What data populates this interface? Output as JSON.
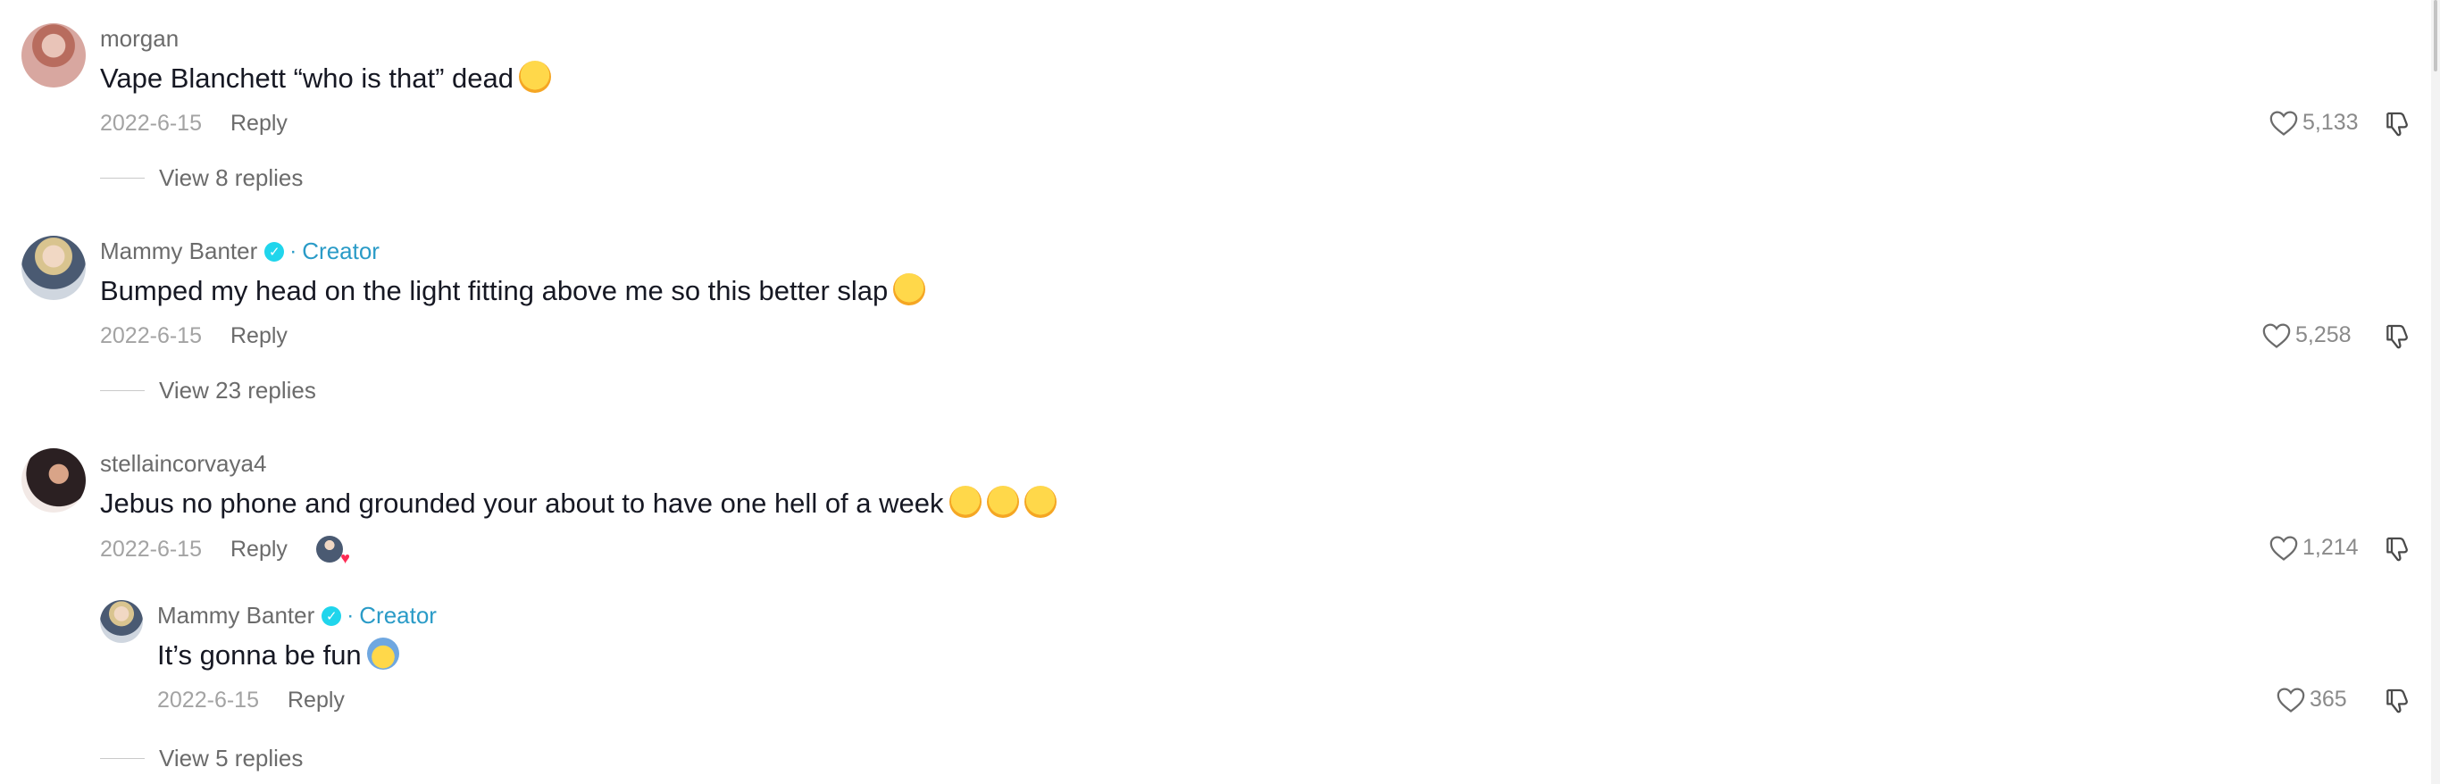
{
  "comments": [
    {
      "username": "morgan",
      "creator": false,
      "text": "Vape Blanchett “who is that” dead",
      "date": "2022-6-15",
      "reply_label": "Reply",
      "likes": "5,133",
      "view_replies": "View 8 replies"
    },
    {
      "username": "Mammy Banter",
      "creator": true,
      "creator_label": "Creator",
      "text": "Bumped my head on the light fitting above me so this better slap",
      "date": "2022-6-15",
      "reply_label": "Reply",
      "likes": "5,258",
      "view_replies": "View 23 replies"
    },
    {
      "username": "stellaincorvaya4",
      "creator": false,
      "text": "Jebus no phone and grounded your about to have one hell of a week",
      "date": "2022-6-15",
      "reply_label": "Reply",
      "likes": "1,214",
      "creator_liked": true,
      "reply": {
        "username": "Mammy Banter",
        "creator_label": "Creator",
        "text": "It’s gonna be fun",
        "date": "2022-6-15",
        "reply_label": "Reply",
        "likes": "365"
      },
      "view_replies": "View 5 replies"
    }
  ],
  "icons": {
    "like": "heart-outline-icon",
    "dislike": "thumbs-down-icon",
    "verified": "verified-badge-icon",
    "emoji_laugh": "tears-of-joy-emoji",
    "emoji_fear": "fearful-face-emoji"
  },
  "colors": {
    "creator": "#2a9bc7",
    "verified": "#20d5ec",
    "text": "#161823",
    "muted": "#6b6b6b",
    "date": "#a3a3a3"
  }
}
